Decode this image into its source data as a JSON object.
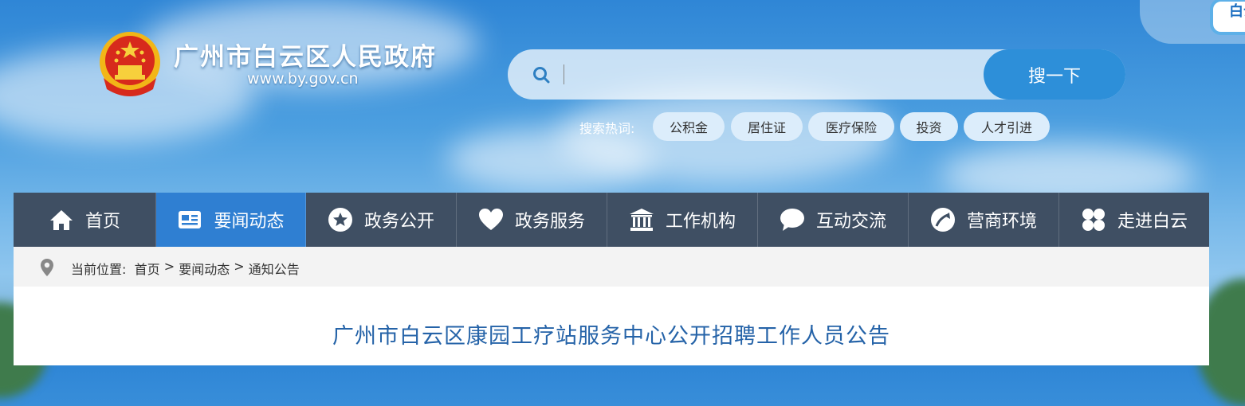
{
  "header": {
    "site_title": "广州市白云区人民政府",
    "site_url": "www.by.gov.cn",
    "logo_icon": "national-emblem-icon",
    "corner_badge": "白云"
  },
  "search": {
    "placeholder": "",
    "button_label": "搜一下",
    "hot_label": "搜索热词:",
    "hot_tags": [
      "公积金",
      "居住证",
      "医疗保险",
      "投资",
      "人才引进"
    ]
  },
  "nav": {
    "items": [
      {
        "label": "首页",
        "icon": "home-icon"
      },
      {
        "label": "要闻动态",
        "icon": "news-icon",
        "active": true
      },
      {
        "label": "政务公开",
        "icon": "star-icon"
      },
      {
        "label": "政务服务",
        "icon": "heart-icon"
      },
      {
        "label": "工作机构",
        "icon": "building-icon"
      },
      {
        "label": "互动交流",
        "icon": "chat-icon"
      },
      {
        "label": "营商环境",
        "icon": "growth-icon"
      },
      {
        "label": "走进白云",
        "icon": "clover-icon"
      }
    ]
  },
  "breadcrumb": {
    "prefix": "当前位置:",
    "items": [
      "首页",
      "要闻动态",
      "通知公告"
    ],
    "separator": ">"
  },
  "article": {
    "title": "广州市白云区康园工疗站服务中心公开招聘工作人员公告"
  },
  "colors": {
    "nav_bg": "#3f4f63",
    "nav_active": "#2f7fd2",
    "title_color": "#2563a8",
    "search_button": "#2d8fd9"
  }
}
